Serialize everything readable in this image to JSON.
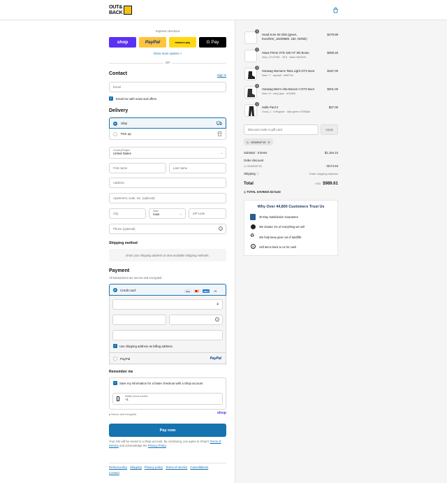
{
  "header": {
    "logo_line1": "OUT&",
    "logo_line2": "BACK",
    "cart_icon": "shopping-bag-icon"
  },
  "express": {
    "title": "Express checkout",
    "buttons": [
      "shop",
      "PayPal",
      "amazon pay",
      "G Pay"
    ],
    "more_options": "Show more options ˅",
    "or": "OR"
  },
  "contact": {
    "title": "Contact",
    "sign_in": "Sign in",
    "email_placeholder": "Email",
    "news_label": "Email me with news and offers"
  },
  "delivery": {
    "title": "Delivery",
    "ship_label": "Ship",
    "pickup_label": "Pick up",
    "country_label": "Country/Region",
    "country_value": "United States",
    "first_name": "First name",
    "last_name": "Last name",
    "address": "Address",
    "apartment": "Apartment, suite, etc. (optional)",
    "city": "City",
    "state_label": "State",
    "state_value": "Iowa",
    "zip": "ZIP code",
    "phone": "Phone (optional)"
  },
  "shipping_method": {
    "title": "Shipping method",
    "note": "Enter your shipping address to view available shipping methods."
  },
  "payment": {
    "title": "Payment",
    "subtitle": "All transactions are secure and encrypted.",
    "credit_card": "Credit card",
    "card_brands": [
      "VISA",
      "MC",
      "AMEX"
    ],
    "more_brands": "+5",
    "billing_same": "Use shipping address as billing address",
    "paypal": "PayPal",
    "paypal_logo": "PayPal"
  },
  "remember": {
    "title": "Remember me",
    "save_info": "Save my information for a faster checkout with a Shop account",
    "mobile_label": "Mobile phone number",
    "mobile_prefix": "+1",
    "secure": "Secure and encrypted",
    "shop_logo": "shop"
  },
  "pay_now": "Pay now",
  "legal": {
    "line1": "Your info will be saved to a Shop account. By continuing, you agree to Shop’s",
    "terms": "Terms of Service",
    "mid": " and acknowledge the ",
    "privacy": "Privacy Policy",
    "end": "."
  },
  "footer": {
    "links": [
      "Refund policy",
      "Shipping",
      "Privacy policy",
      "Terms of service",
      "Cancellations",
      "Contact"
    ]
  },
  "order": {
    "items": [
      {
        "qty": "1",
        "name": "Head Kore 93 Skis (green, Excellent_16239689, 182, NONE)",
        "sub": "",
        "price": "$479.99"
      },
      {
        "qty": "1",
        "name": "Hawx Prime XTD 100 HT Ski Boots",
        "sub": "New_17147991 · 25.5 · black #302591",
        "price": "$259.25"
      },
      {
        "qty": "1",
        "name": "Hanwag Womens Tatra Light GTX Boot",
        "sub": "New / 7 · asphalt · #M07Xb",
        "price": "$187.00"
      },
      {
        "qty": "1",
        "name": "Hanwag Men's Alta Bunion II GTX Boot",
        "sub": "New / 8 · navy grey · #G4450",
        "price": "$201.00"
      },
      {
        "qty": "1",
        "name": "Halle Pant II",
        "sub": "Good_1 · 8 Regular · dark green #79868a",
        "price": "$37.00"
      }
    ],
    "discount_placeholder": "Discount code or gift card",
    "apply": "Apply",
    "code_tag": "GEARUP15",
    "subtotal_label": "Subtotal · 5 items",
    "subtotal_value": "$1,164.24",
    "order_discount_label": "Order discount",
    "discount_code": "GEARUP15",
    "discount_value": "−$174.63",
    "shipping_label": "Shipping",
    "shipping_value": "Enter shipping address",
    "total_label": "Total",
    "currency": "USD",
    "total_value": "$989.61",
    "savings_label": "TOTAL SAVINGS",
    "savings_value": "$174.63"
  },
  "trust": {
    "title": "Why Over 44,800 Customers Trust Us",
    "items": [
      "30-Day Satisfaction Guarantee",
      "We donate 1% of everything we sell",
      "We help keep gear out of landfills",
      "Sell items back to us for cash"
    ]
  },
  "colors": {
    "accent": "#1773b0",
    "shop": "#5a31f4",
    "paypal": "#ffc439",
    "amazon": "#ffd814"
  }
}
